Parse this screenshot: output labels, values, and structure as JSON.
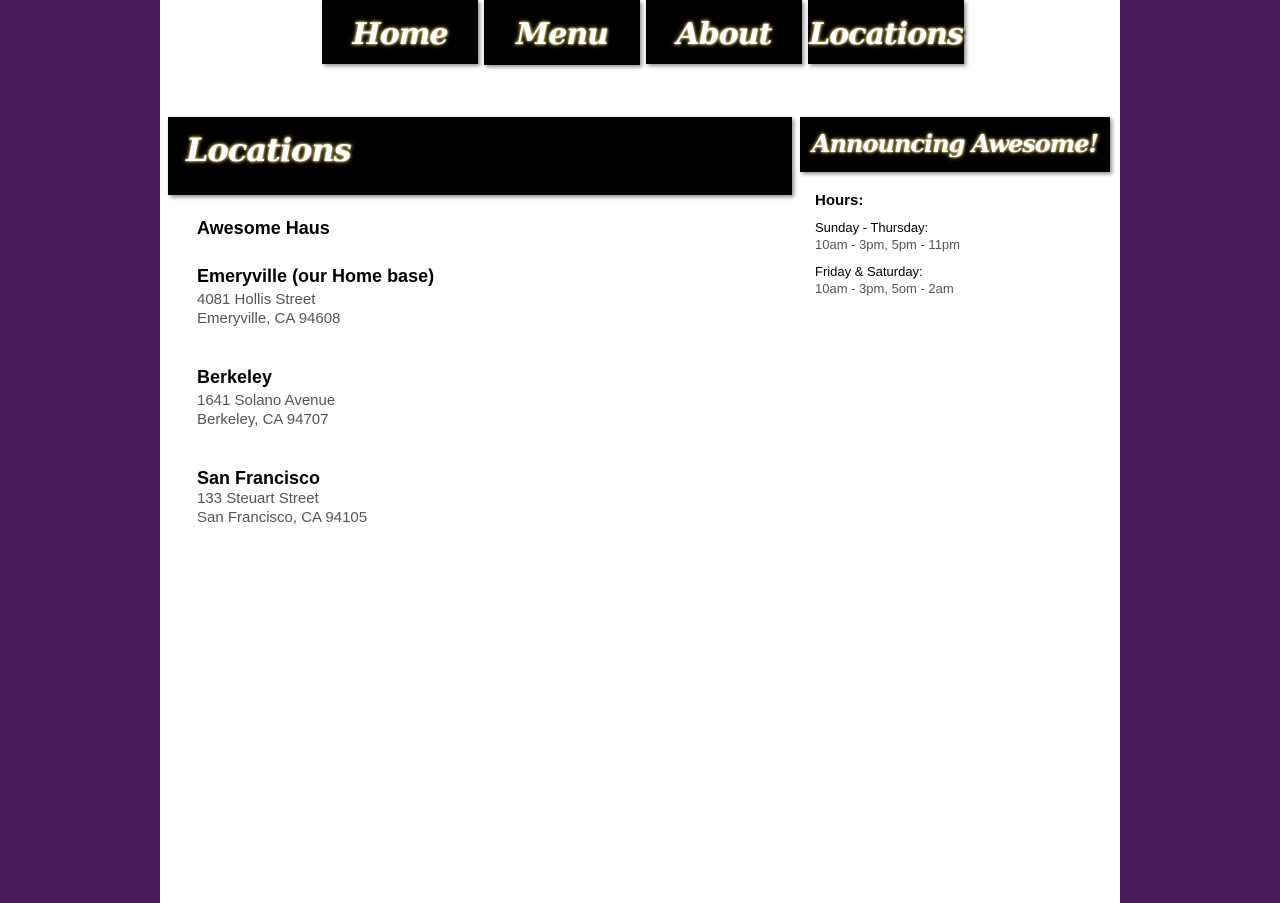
{
  "nav": {
    "items": [
      {
        "label": "Home"
      },
      {
        "label": "Menu"
      },
      {
        "label": "About"
      },
      {
        "label": "Locations"
      }
    ]
  },
  "main": {
    "title": "Locations",
    "brand": "Awesome Haus",
    "locations": [
      {
        "name": "Emeryville (our Home base)",
        "street": "4081 Hollis Street",
        "city": "Emeryville, CA 94608"
      },
      {
        "name": "Berkeley",
        "street": "1641 Solano Avenue",
        "city": "Berkeley, CA 94707"
      },
      {
        "name": "San Francisco",
        "street": "133 Steuart Street",
        "city": "San Francisco, CA 94105"
      }
    ]
  },
  "sidebar": {
    "title": "Announcing Awesome!",
    "hours_label": "Hours:",
    "schedule": [
      {
        "days": "Sunday - Thursday:",
        "times": "10am - 3pm, 5pm - 11pm"
      },
      {
        "days": "Friday & Saturday:",
        "times": "10am - 3pm, 5om - 2am"
      }
    ]
  },
  "colors": {
    "background": "#4a1e5c",
    "page": "#ffffff",
    "header": "#000000",
    "glow": "#e8c869"
  }
}
